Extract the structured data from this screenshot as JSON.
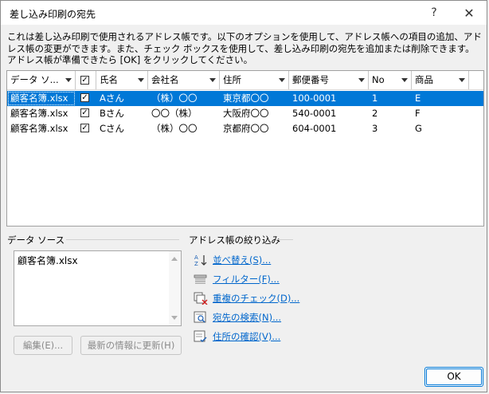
{
  "window": {
    "title": "差し込み印刷の宛先",
    "help_glyph": "?",
    "close_glyph": "✕"
  },
  "description": "これは差し込み印刷で使用されるアドレス帳です。以下のオプションを使用して、アドレス帳への項目の追加、アドレス帳の変更ができます。また、チェック ボックスを使用して、差し込み印刷の宛先を追加または削除できます。アドレス帳が準備できたら [OK] をクリックしてください。",
  "table": {
    "columns": [
      "データ ソ...",
      "",
      "氏名",
      "会社名",
      "住所",
      "郵便番号",
      "No",
      "商品"
    ],
    "rows": [
      {
        "source": "顧客名簿.xlsx",
        "checked": true,
        "name": "Aさん",
        "company": "（株）〇〇",
        "address": "東京都〇〇",
        "zip": "100-0001",
        "no": "1",
        "product": "E",
        "selected": true
      },
      {
        "source": "顧客名簿.xlsx",
        "checked": true,
        "name": "Bさん",
        "company": "〇〇（株）",
        "address": "大阪府〇〇",
        "zip": "540-0001",
        "no": "2",
        "product": "F",
        "selected": false
      },
      {
        "source": "顧客名簿.xlsx",
        "checked": true,
        "name": "Cさん",
        "company": "（株）〇〇",
        "address": "京都府〇〇",
        "zip": "604-0001",
        "no": "3",
        "product": "G",
        "selected": false
      }
    ]
  },
  "data_source": {
    "label": "データ ソース",
    "items": [
      "顧客名簿.xlsx"
    ],
    "edit_button": "編集(E)...",
    "refresh_button": "最新の情報に更新(H)"
  },
  "refine": {
    "label": "アドレス帳の絞り込み",
    "links": [
      {
        "label": "並べ替え(S)...",
        "icon": "sort-az-icon"
      },
      {
        "label": "フィルター(F)...",
        "icon": "filter-icon"
      },
      {
        "label": "重複のチェック(D)...",
        "icon": "duplicate-check-icon"
      },
      {
        "label": "宛先の検索(N)...",
        "icon": "find-recipient-icon"
      },
      {
        "label": "住所の確認(V)...",
        "icon": "validate-address-icon"
      }
    ]
  },
  "ok_button": "OK",
  "colors": {
    "selection": "#0078d7",
    "link": "#0066cc",
    "background": "#f0f0f0"
  }
}
